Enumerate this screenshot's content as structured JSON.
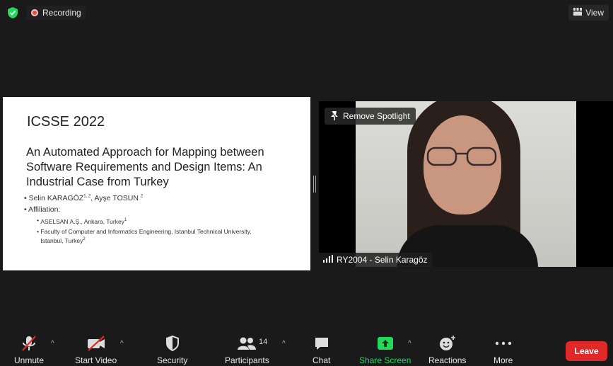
{
  "topbar": {
    "recording_label": "Recording",
    "view_label": "View"
  },
  "slide": {
    "conference": "ICSSE 2022",
    "title": "An Automated Approach for Mapping between Software Requirements and Design Items: An Industrial Case from Turkey",
    "authors_a": "Selin KARAGÖZ",
    "authors_a_sup": "1, 2",
    "authors_b": ", Ayşe TOSUN",
    "authors_b_sup": "2",
    "affiliation_label": "Affiliation:",
    "affiliations": [
      {
        "text": "ASELSAN A.Ş., Ankara, Turkey",
        "sup": "1"
      },
      {
        "text": "Faculty of Computer and Informatics Engineering, Istanbul Technical University, Istanbul, Turkey",
        "sup": "2"
      }
    ]
  },
  "video": {
    "remove_spotlight_label": "Remove Spotlight",
    "participant_name": "RY2004 - Selin Karagöz"
  },
  "toolbar": {
    "unmute": "Unmute",
    "start_video": "Start Video",
    "security": "Security",
    "participants": "Participants",
    "participants_count": "14",
    "chat": "Chat",
    "share_screen": "Share Screen",
    "reactions": "Reactions",
    "more": "More",
    "leave": "Leave",
    "caret": "^"
  },
  "colors": {
    "background": "#1a1a1a",
    "share_green": "#23d959",
    "leave_red": "#e02828",
    "muted_red": "#e02828"
  }
}
